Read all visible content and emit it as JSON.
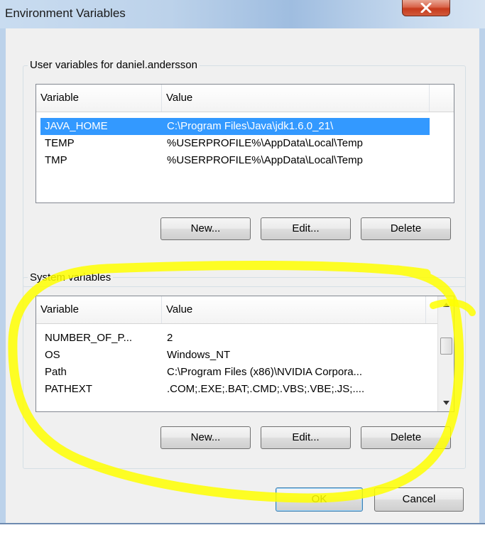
{
  "window": {
    "title": "Environment Variables",
    "close_glyph": "X"
  },
  "user_vars": {
    "group_label": "User variables for daniel.andersson",
    "columns": [
      "Variable",
      "Value"
    ],
    "rows": [
      {
        "variable": "JAVA_HOME",
        "value": "C:\\Program Files\\Java\\jdk1.6.0_21\\",
        "selected": true
      },
      {
        "variable": "TEMP",
        "value": "%USERPROFILE%\\AppData\\Local\\Temp",
        "selected": false
      },
      {
        "variable": "TMP",
        "value": "%USERPROFILE%\\AppData\\Local\\Temp",
        "selected": false
      }
    ],
    "buttons": {
      "new": "New...",
      "edit": "Edit...",
      "delete": "Delete"
    }
  },
  "system_vars": {
    "group_label": "System variables",
    "columns": [
      "Variable",
      "Value"
    ],
    "rows": [
      {
        "variable": "NUMBER_OF_P...",
        "value": "2"
      },
      {
        "variable": "OS",
        "value": "Windows_NT"
      },
      {
        "variable": "Path",
        "value": "C:\\Program Files (x86)\\NVIDIA Corpora..."
      },
      {
        "variable": "PATHEXT",
        "value": ".COM;.EXE;.BAT;.CMD;.VBS;.VBE;.JS;...."
      }
    ],
    "buttons": {
      "new": "New...",
      "edit": "Edit...",
      "delete": "Delete"
    }
  },
  "footer": {
    "ok": "OK",
    "cancel": "Cancel"
  },
  "colors": {
    "selection": "#3399ff",
    "highlight_marker": "#ffff00"
  }
}
